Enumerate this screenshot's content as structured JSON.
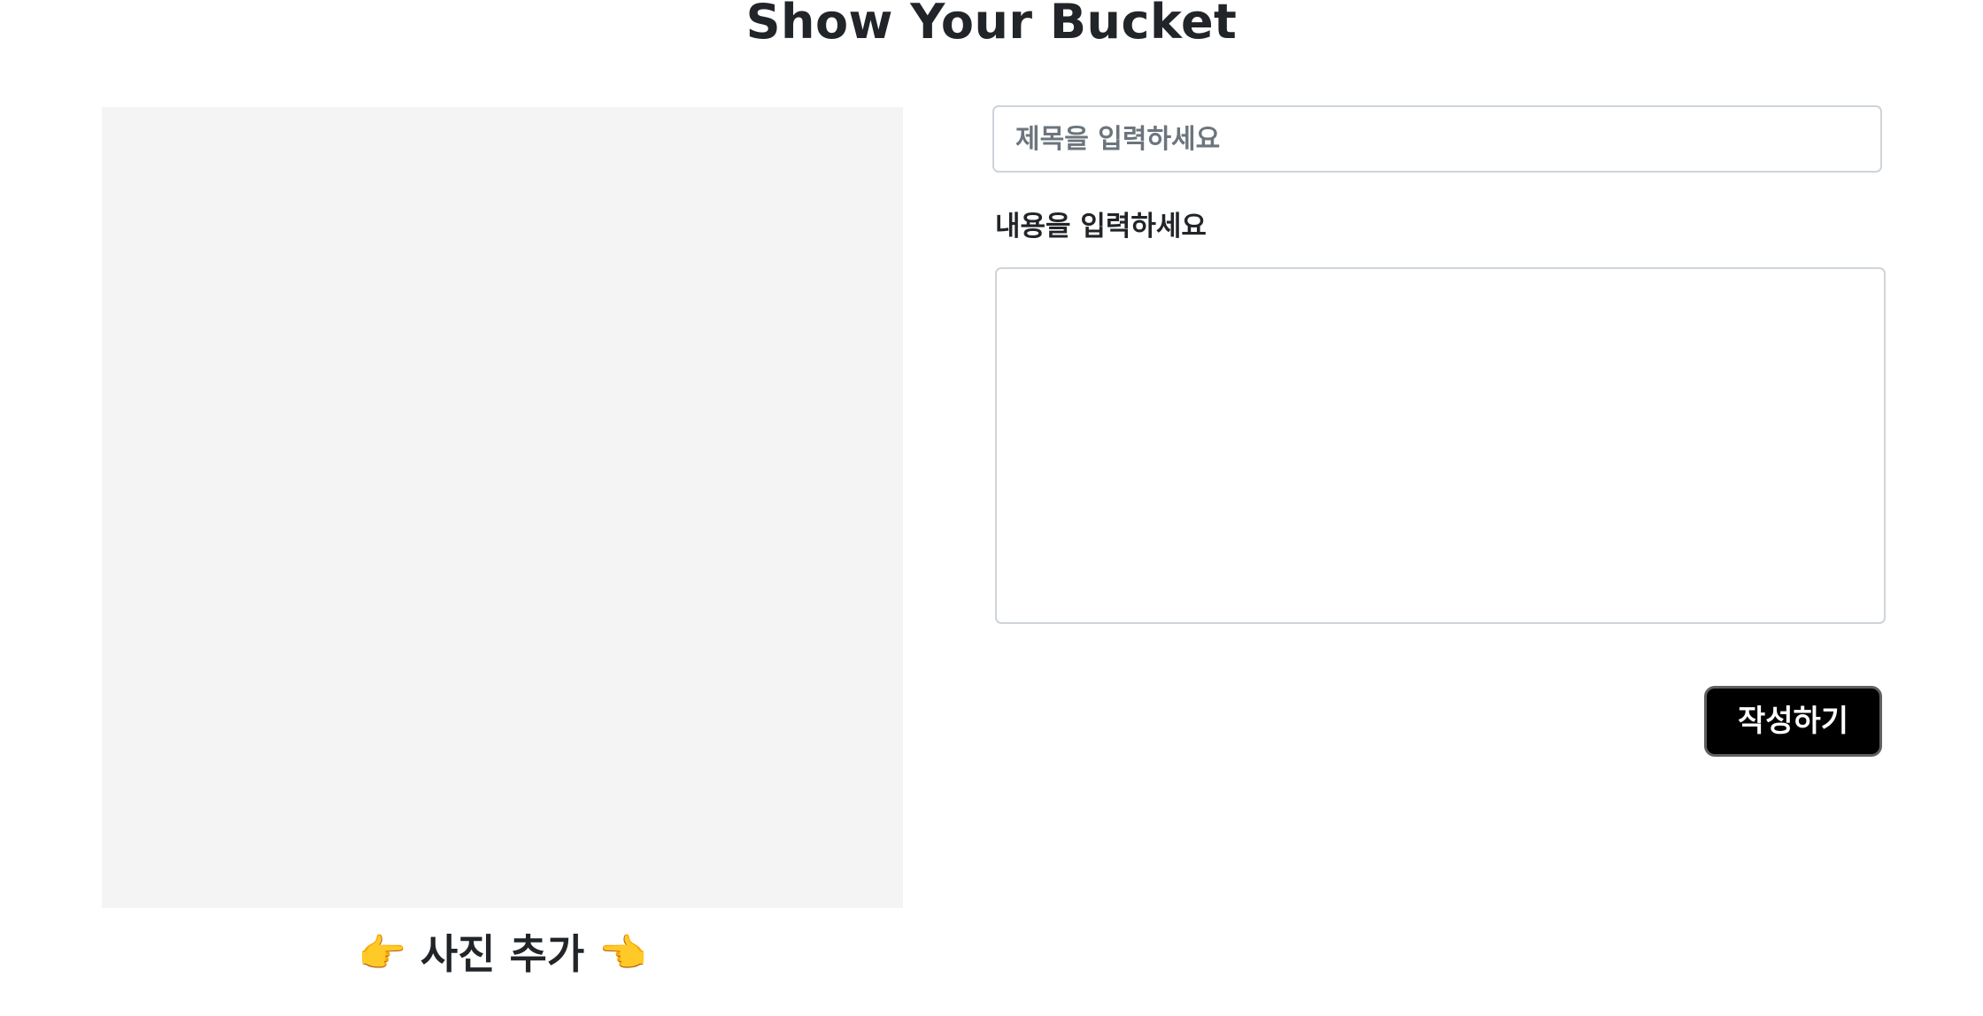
{
  "header": {
    "title": "Show Your Bucket"
  },
  "photo": {
    "add_label": "사진 추가",
    "left_icon": "point-right-icon",
    "right_icon": "point-left-icon",
    "box_color": "#f4f4f4"
  },
  "form": {
    "title_placeholder": "제목을 입력하세요",
    "title_value": "",
    "content_label": "내용을 입력하세요",
    "content_value": "",
    "submit_label": "작성하기"
  },
  "colors": {
    "text": "#212529",
    "button_bg": "#000000",
    "button_text": "#ffffff",
    "input_border": "#ced4da",
    "placeholder": "#6c757d",
    "hand_emoji": "#f2b233"
  }
}
